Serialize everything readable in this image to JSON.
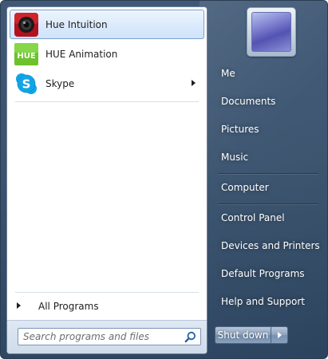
{
  "programs": [
    {
      "label": "Hue Intuition",
      "icon": "hue-intuition-icon",
      "selected": true
    },
    {
      "label": "HUE Animation",
      "icon": "hue-animation-icon",
      "icon_text": "HUE"
    },
    {
      "label": "Skype",
      "icon": "skype-icon",
      "has_submenu": true
    }
  ],
  "all_programs_label": "All Programs",
  "search": {
    "placeholder": "Search programs and files",
    "icon": "search-icon"
  },
  "right_links": [
    "Me",
    "Documents",
    "Pictures",
    "Music",
    "Computer",
    "Control Panel",
    "Devices and Printers",
    "Default Programs",
    "Help and Support"
  ],
  "shutdown": {
    "label": "Shut down",
    "options_icon": "chevron-right-icon"
  },
  "colors": {
    "menu_background": "#3b546f",
    "selection_border": "#7da2ce",
    "hue_green": "#6dc22c",
    "skype_blue": "#12a5e6",
    "hue_intuition_red": "#b3111b"
  }
}
